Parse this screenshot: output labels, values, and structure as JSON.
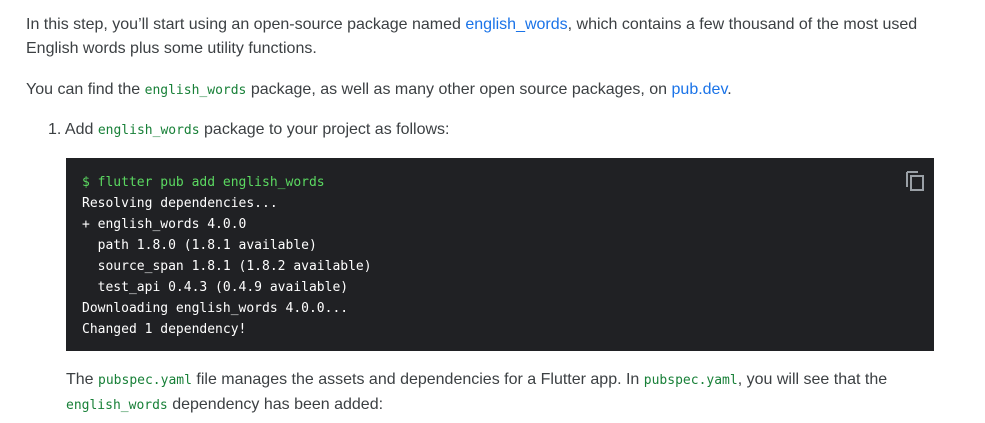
{
  "p1": {
    "before": "In this step, you’ll start using an open-source package named ",
    "link": "english_words",
    "after": ", which contains a few thousand of the most used English words plus some utility functions."
  },
  "p2": {
    "before": "You can find the ",
    "code": "english_words",
    "middle": " package, as well as many other open source packages, on ",
    "link": "pub.dev",
    "after": "."
  },
  "step1": {
    "number": "1.",
    "before": " Add ",
    "code": "english_words",
    "after": " package to your project as follows:"
  },
  "codeblock": {
    "command": "$ flutter pub add english_words",
    "output": [
      "Resolving dependencies...",
      "+ english_words 4.0.0",
      "  path 1.8.0 (1.8.1 available)",
      "  source_span 1.8.1 (1.8.2 available)",
      "  test_api 0.4.3 (0.4.9 available)",
      "Downloading english_words 4.0.0...",
      "Changed 1 dependency!"
    ],
    "copy_icon": "copy-icon"
  },
  "p3": {
    "t1": "The ",
    "code1": "pubspec.yaml",
    "t2": " file manages the assets and dependencies for a Flutter app. In ",
    "code2": "pubspec.yaml",
    "t3": ", you will see that the ",
    "code3": "english_words",
    "t4": " dependency has been added:"
  }
}
